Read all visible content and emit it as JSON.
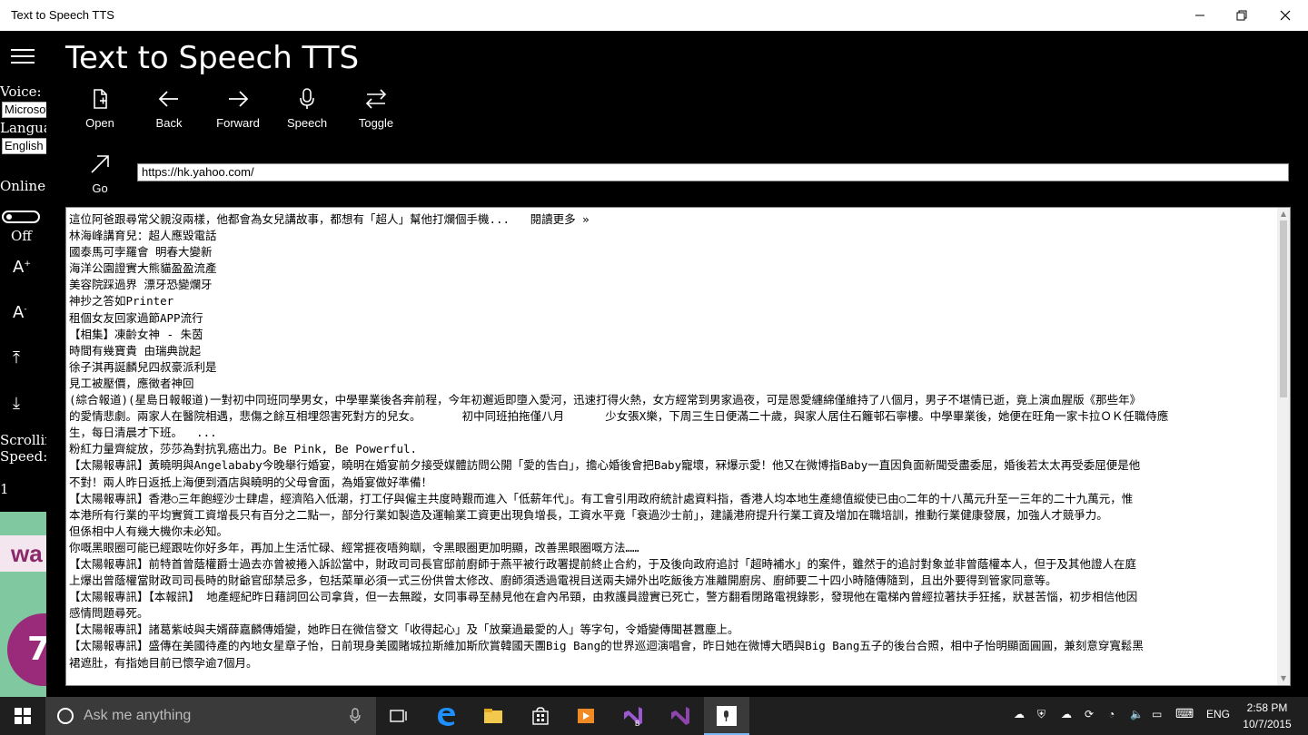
{
  "window": {
    "title": "Text to Speech TTS"
  },
  "app": {
    "title": "Text to Speech TTS"
  },
  "toolbar": {
    "open": "Open",
    "back": "Back",
    "forward": "Forward",
    "speech": "Speech",
    "toggle": "Toggle",
    "go": "Go"
  },
  "url_bar": {
    "value": "https://hk.yahoo.com/"
  },
  "side": {
    "voice_label": "Voice:",
    "voice_value": "Microsoft",
    "language_label": "Language",
    "language_value": "English",
    "online_label": "Online",
    "toggle_state": "Off",
    "scrolling_label": "Scrolling",
    "speed_label": "Speed:",
    "speed_value": "1"
  },
  "content": {
    "lines": [
      "這位阿爸跟尋常父親沒兩樣，他都會為女兒講故事，都想有「超人」幫他打爛個手機...   閱讀更多 »",
      "林海峰講育兒：超人應毀電話",
      "國泰馬可孛羅會 明春大變新",
      "海洋公園證實大熊貓盈盈流產",
      "美容院踩過界 漂牙恐變爛牙",
      "神抄之答如Printer",
      "租個女友回家過節APP流行",
      "【相集】凍齡女神 - 朱茵",
      "時間有幾寶貴 由瑞典說起",
      "徐子淇再誕麟兒四叔豪派利是",
      "見工被壓價，應徵者神回",
      "(綜合報道)(星島日報報道)一對初中同班同學男女，中學畢業後各奔前程，今年初邂逅即墮入愛河，迅速打得火熱，女方經常到男家過夜，可是恩愛纏綿僅維持了八個月，男子不堪情已逝，竟上演血腥版《那些年》",
      "的愛情悲劇。兩家人在醫院相遇，悲傷之餘互相埋怨害死對方的兒女。      初中同班拍拖僅八月      少女張X樂，下周三生日便滿二十歲，與家人居住石籬邨石寧樓。中學畢業後，她便在旺角一家卡拉ＯＫ任職侍應",
      "生，每日清晨才下班。  ...",
      "粉紅力量齊綻放，莎莎為對抗乳癌出力。Be Pink, Be Powerful.",
      "【太陽報專訊】黃曉明與Angelababy今晚舉行婚宴，曉明在婚宴前夕接受媒體訪問公開「愛的告白」，擔心婚後會把Baby寵壞，冧爆示愛！他又在微博指Baby一直因負面新聞受盡委屈，婚後若太太再受委屈便是他",
      "不對！兩人昨日返抵上海便到酒店與曉明的父母會面，為婚宴做好準備！",
      "【太陽報專訊】香港○三年飽經沙士肆虐，經濟陷入低潮，打工仔與僱主共度時艱而進入「低薪年代」。有工會引用政府統計處資料指，香港人均本地生產總值縱使已由○二年的十八萬元升至一三年的二十九萬元，惟",
      "本港所有行業的平均實質工資增長只有百分之二點一，部分行業如製造及運輸業工資更出現負增長，工資水平竟「衰過沙士前」，建議港府提升行業工資及增加在職培訓，推動行業健康發展，加強人才競爭力。",
      "但係相中人有幾大機你未必知。",
      "你嘅黑眼圈可能已經跟咗你好多年，再加上生活忙碌、經常捱夜唔夠瞓，令黑眼圈更加明顯，改善黑眼圈嘅方法……",
      "【太陽報專訊】前特首曾蔭權爵士過去亦曾被捲入訴訟當中，財政司司長官邸前廚師于燕平被行政署提前終止合約，于及後向政府追討「超時補水」的案件，雖然于的追討對象並非曾蔭權本人，但于及其他證人在庭",
      "上爆出曾蔭權當財政司司長時的財爺官邸禁忌多，包括菜單必須一式三份供曾太修改、廚師須透過電視目送兩夫婦外出吃飯後方准離開廚房、廚師要二十四小時隨傳隨到，且出外要得到管家同意等。",
      "【太陽報專訊】【本報訊】 地產經紀昨日藉詞回公司拿貨，但一去無蹤，女同事尋至赫見他在倉內吊頸，由救護員證實已死亡，警方翻看閉路電視錄影，發現他在電梯內曾經拉著扶手狂搖，狀甚苦惱，初步相信他因",
      "感情問題尋死。",
      "【太陽報專訊】諸葛紫岐與夫婿薛嘉麟傳婚變，她昨日在微信發文「收得起心」及「放棄過最愛的人」等字句，令婚變傳聞甚囂塵上。",
      "【太陽報專訊】盛傳在美國待產的內地女星章子怡，日前現身美國賭城拉斯維加斯欣賞韓國天團Big Bang的世界巡迴演唱會，昨日她在微博大晒與Big Bang五子的後台合照，相中子怡明顯面圓圓，兼刻意穿寬鬆黑",
      "裙遮肚，有指她目前已懷孕逾7個月。"
    ]
  },
  "taskbar": {
    "search_placeholder": "Ask me anything",
    "language": "ENG",
    "time": "2:58 PM",
    "date": "10/7/2015"
  }
}
